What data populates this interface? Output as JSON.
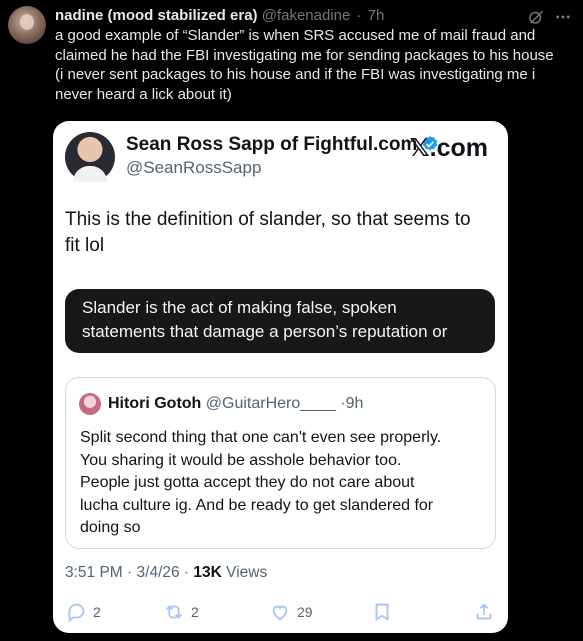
{
  "post": {
    "display_name": "nadine (mood stabilized era)",
    "handle": "@fakenadine",
    "separator": "·",
    "time": "7h",
    "text_lines": [
      "a good example of “Slander” is when SRS accused me of mail fraud and",
      "claimed he had the FBI investigating me for sending packages to his house",
      "(i never sent packages to his house and if the FBI was investigating me i",
      "never heard a lick about it)"
    ],
    "icons": {
      "grok": "grok-icon",
      "more": "more-icon"
    }
  },
  "screenshot_card": {
    "author_name": "Sean Ross Sapp of Fightful.com",
    "author_handle": "@SeanRossSapp",
    "brand_glyph": "𝕏",
    "brand_text": ".com",
    "text_lines": [
      "This is the definition of slander, so that seems to",
      "fit lol"
    ],
    "definition_lines": [
      "Slander is the act of making false, spoken",
      "statements that damage a person’s reputation or"
    ],
    "quote": {
      "name": "Hitori Gotoh",
      "handle": "@GuitarHero____",
      "separator": "·",
      "time": "9h",
      "text_lines": [
        "Split second thing that one can't even see properly.",
        "You sharing it would be asshole behavior too.",
        "People just gotta accept they do not care about",
        "lucha culture ig. And be ready to get slandered for",
        "doing so"
      ]
    },
    "meta": {
      "time": "3:51 PM",
      "sep1": " · ",
      "date": "3/4/26",
      "sep2": " · ",
      "views_count": "13K",
      "views_label": " Views"
    },
    "actions": {
      "replies": "2",
      "reposts": "2",
      "likes": "29"
    },
    "colors": {
      "verified": "#1d9bf0",
      "action_icons": "#a4c7f0"
    }
  }
}
